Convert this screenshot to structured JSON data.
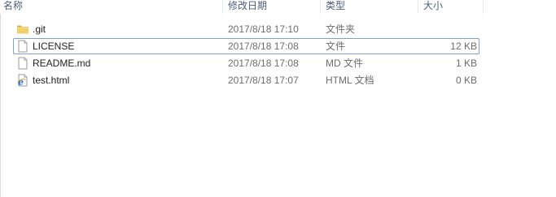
{
  "columns": {
    "name": "名称",
    "date": "修改日期",
    "type": "类型",
    "size": "大小"
  },
  "files": [
    {
      "name": ".git",
      "date": "2017/8/18 17:10",
      "type": "文件夹",
      "size": "",
      "icon": "folder-icon"
    },
    {
      "name": "LICENSE",
      "date": "2017/8/18 17:08",
      "type": "文件",
      "size": "12 KB",
      "icon": "file-icon",
      "focused": true
    },
    {
      "name": "README.md",
      "date": "2017/8/18 17:08",
      "type": "MD 文件",
      "size": "1 KB",
      "icon": "file-icon"
    },
    {
      "name": "test.html",
      "date": "2017/8/18 17:07",
      "type": "HTML 文档",
      "size": "0 KB",
      "icon": "ie-document-icon"
    }
  ]
}
